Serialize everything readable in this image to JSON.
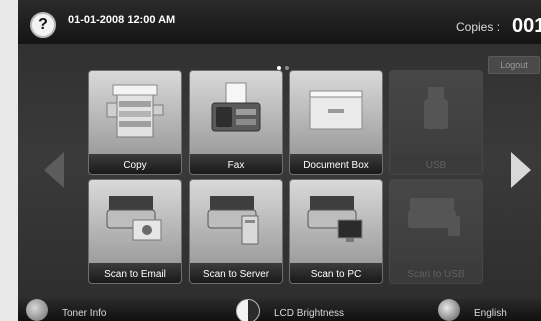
{
  "header": {
    "datetime": "01-01-2008 12:00 AM",
    "copies_label": "Copies :",
    "copies_value": "001"
  },
  "logout_label": "Logout",
  "pager": {
    "current": 1,
    "total": 2
  },
  "apps": [
    {
      "label": "Copy",
      "enabled": true,
      "icon": "copier-icon"
    },
    {
      "label": "Fax",
      "enabled": true,
      "icon": "fax-icon"
    },
    {
      "label": "Document Box",
      "enabled": true,
      "icon": "document-box-icon"
    },
    {
      "label": "USB",
      "enabled": false,
      "icon": "usb-icon"
    },
    {
      "label": "Scan to Email",
      "enabled": true,
      "icon": "scan-email-icon"
    },
    {
      "label": "Scan to Server",
      "enabled": true,
      "icon": "scan-server-icon"
    },
    {
      "label": "Scan to PC",
      "enabled": true,
      "icon": "scan-pc-icon"
    },
    {
      "label": "Scan to USB",
      "enabled": false,
      "icon": "scan-usb-icon"
    }
  ],
  "footer": {
    "toner_label": "Toner Info",
    "brightness_label": "LCD Brightness",
    "language_label": "English"
  }
}
